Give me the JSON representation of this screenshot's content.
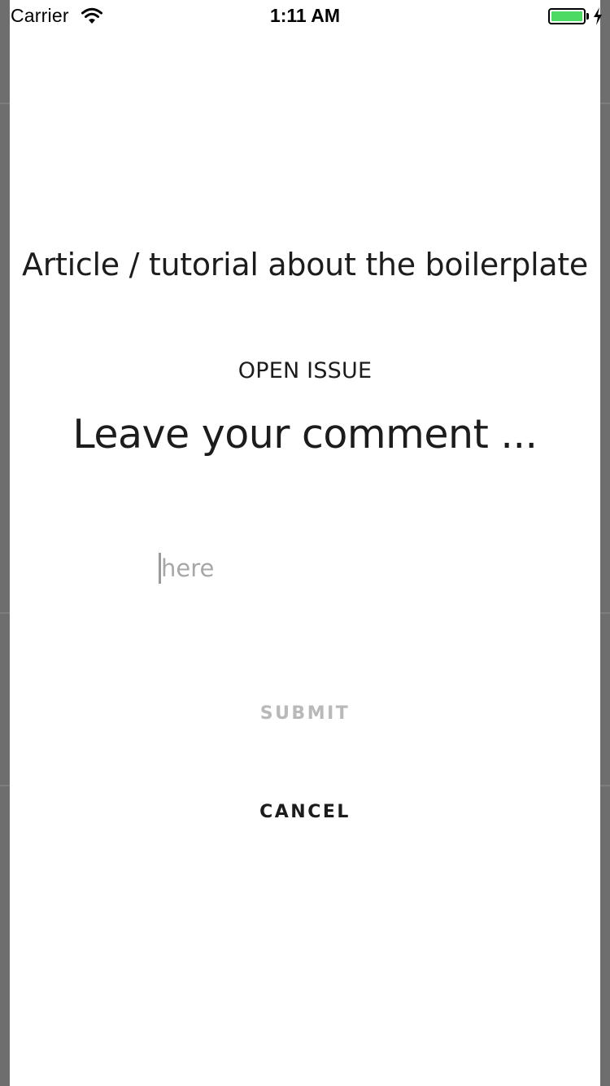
{
  "status_bar": {
    "carrier": "Carrier",
    "time": "1:11 AM",
    "battery_color": "#4cd964"
  },
  "icons": {
    "wifi": "wifi-icon",
    "battery": "battery-icon",
    "charging": "charging-bolt-icon"
  },
  "modal": {
    "title": "Article / tutorial about the boilerplate",
    "status_label": "OPEN ISSUE",
    "headline": "Leave your comment ...",
    "comment": {
      "value": "",
      "placeholder": "here"
    },
    "submit_label": "SUBMIT",
    "cancel_label": "CANCEL"
  },
  "colors": {
    "overlay": "#6e6e6e",
    "modal_background": "#ffffff",
    "text": "#1c1c1c",
    "disabled_text": "#b9b9b9"
  }
}
